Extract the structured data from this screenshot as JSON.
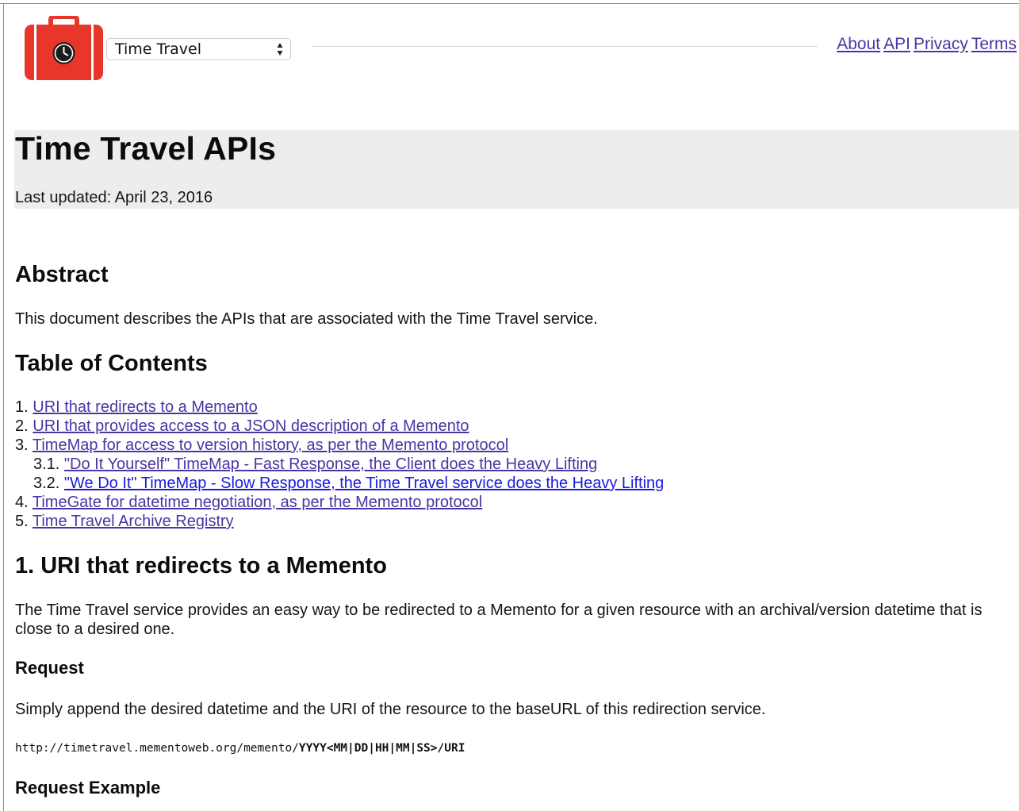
{
  "header": {
    "service_select": {
      "selected": "Time Travel"
    },
    "nav_links": [
      "About",
      "API",
      "Privacy",
      "Terms"
    ]
  },
  "colors": {
    "logo_red": "#e8362b",
    "link_purple": "#4b35a3",
    "link_blue": "#1a1ae0",
    "banner_gray": "#ededed"
  },
  "page": {
    "title": "Time Travel APIs",
    "last_updated": "Last updated: April 23, 2016"
  },
  "abstract": {
    "heading": "Abstract",
    "text": "This document describes the APIs that are associated with the Time Travel service."
  },
  "toc": {
    "heading": "Table of Contents",
    "items": [
      {
        "number": "1.",
        "label": "URI that redirects to a Memento"
      },
      {
        "number": "2.",
        "label": "URI that provides access to a JSON description of a Memento"
      },
      {
        "number": "3.",
        "label": "TimeMap for access to version history, as per the Memento protocol"
      },
      {
        "number": "3.1.",
        "label": "\"Do It Yourself\" TimeMap - Fast Response, the Client does the Heavy Lifting"
      },
      {
        "number": "3.2.",
        "label": "\"We Do It\" TimeMap - Slow Response, the Time Travel service does the Heavy Lifting"
      },
      {
        "number": "4.",
        "label": "TimeGate for datetime negotiation, as per the Memento protocol"
      },
      {
        "number": "5.",
        "label": "Time Travel Archive Registry"
      }
    ]
  },
  "section1": {
    "heading": "1. URI that redirects to a Memento",
    "intro_line1": "The Time Travel service provides an easy way to be redirected to a Memento for a given resource with an archival/version datetime that is",
    "intro_line2": "close to a desired one.",
    "request_heading": "Request",
    "request_text": "Simply append the desired datetime and the URI of the resource to the baseURL of this redirection service.",
    "url_base": "http://timetravel.mementoweb.org/memento/",
    "url_template": "YYYY<MM|DD|HH|MM|SS>/URI",
    "request_example_heading": "Request Example"
  }
}
